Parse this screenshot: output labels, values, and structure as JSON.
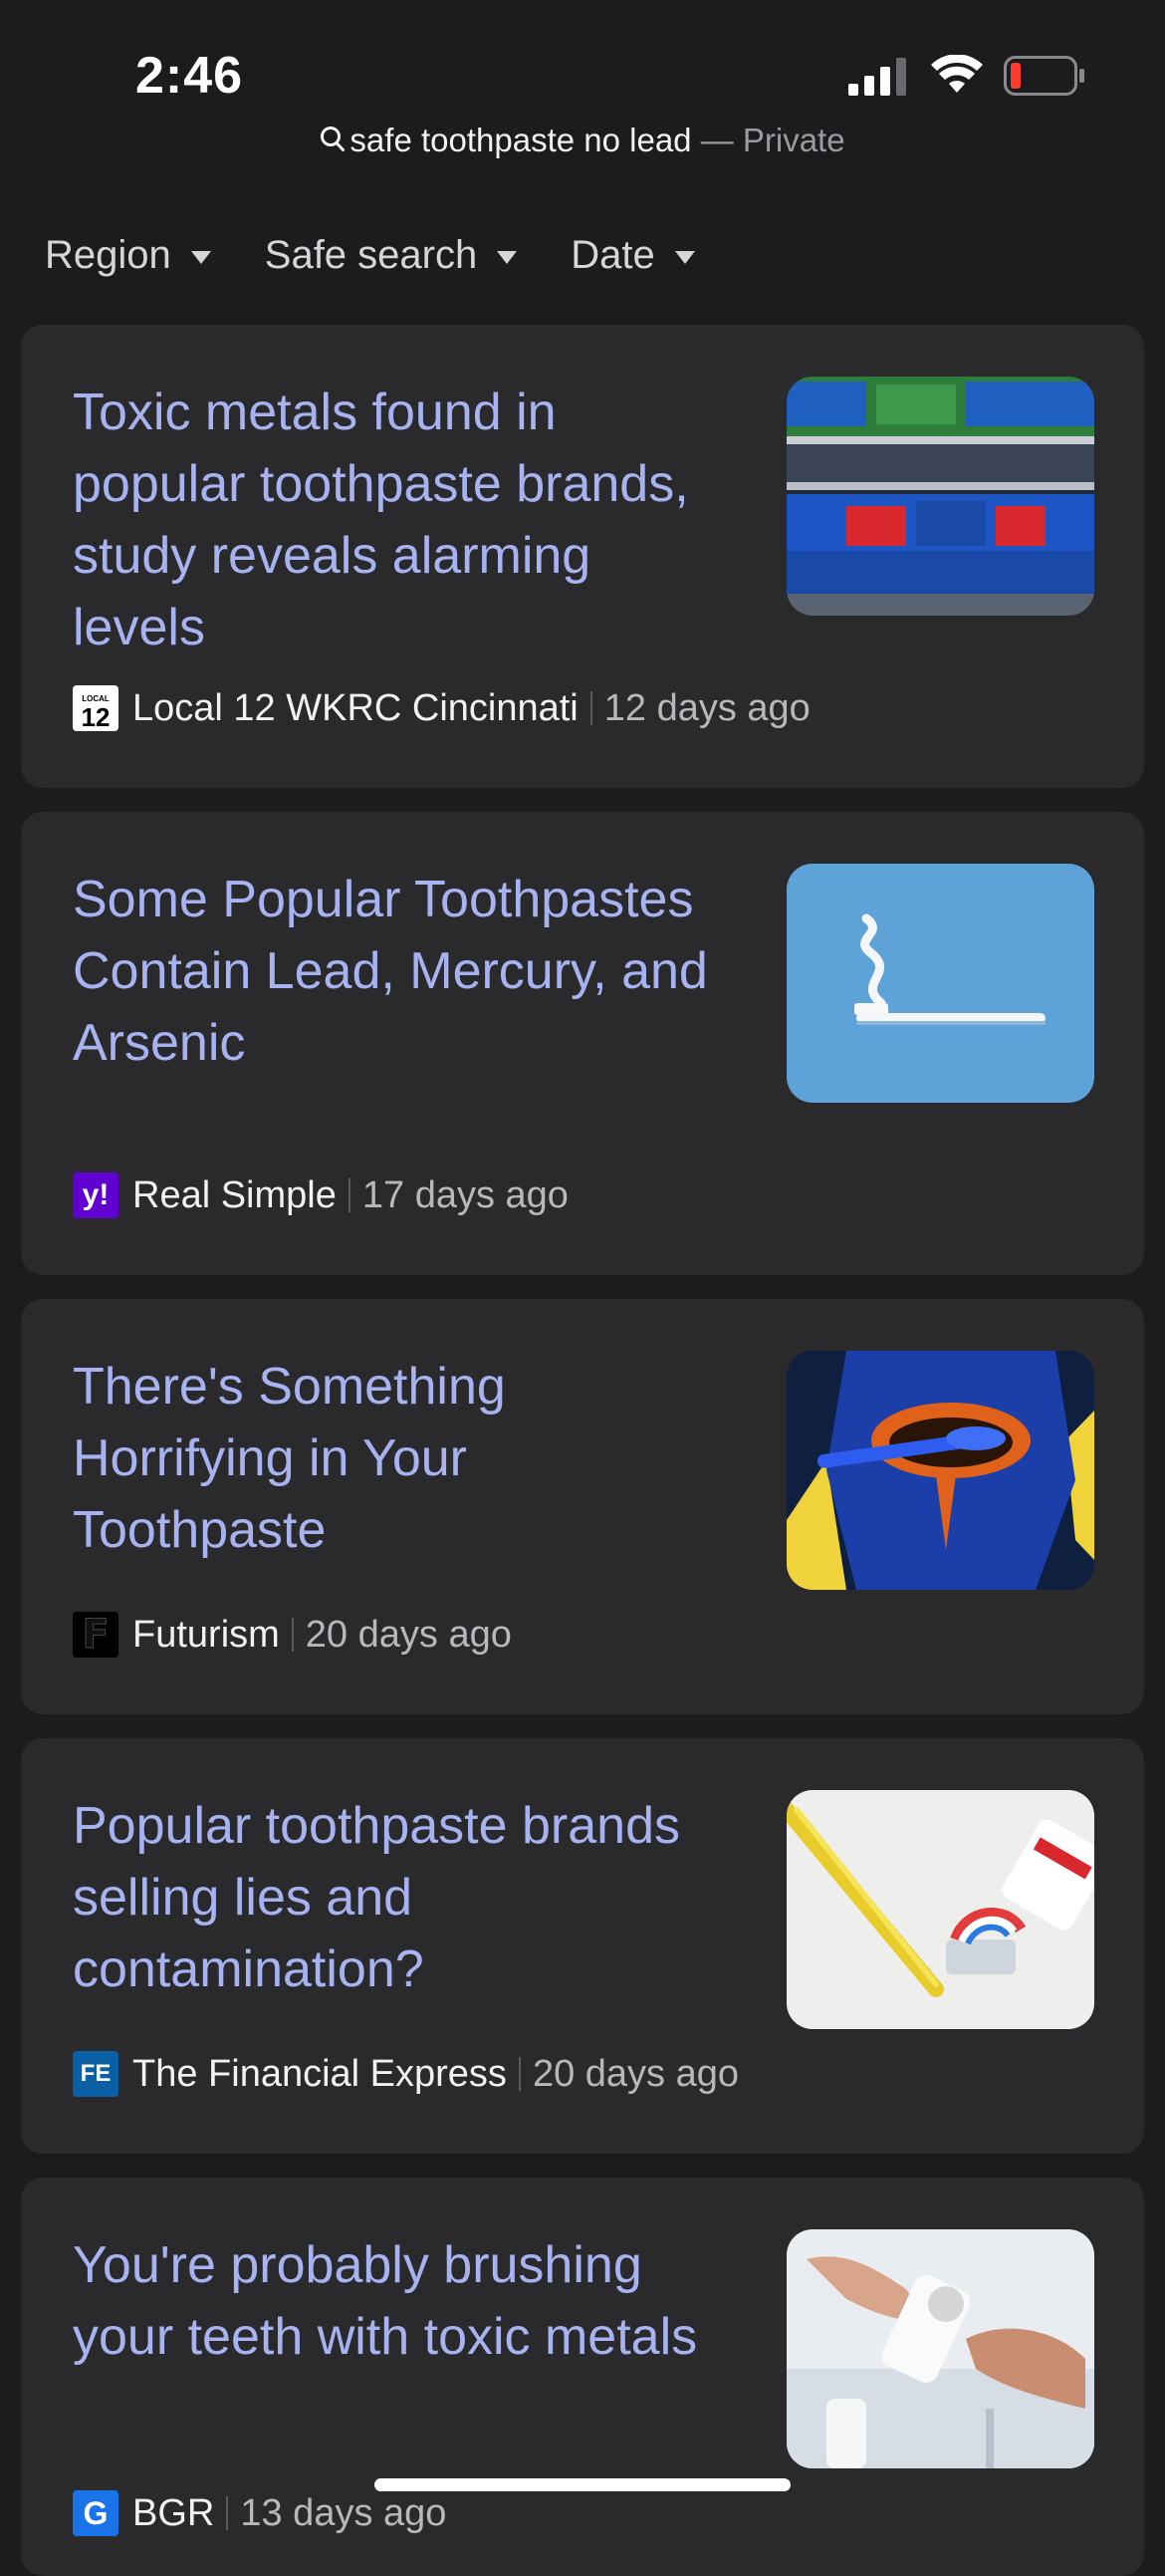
{
  "status_bar": {
    "time": "2:46"
  },
  "search": {
    "query": "safe toothpaste no lead",
    "mode": "— Private"
  },
  "filters": [
    {
      "label": "Region"
    },
    {
      "label": "Safe search"
    },
    {
      "label": "Date"
    }
  ],
  "results": [
    {
      "title": "Toxic metals found in popular toothpaste brands, study reveals alarming levels",
      "source": "Local 12 WKRC Cincinnati",
      "age": "12 days ago",
      "favicon_text": "12",
      "favicon_label": "LOCAL"
    },
    {
      "title": "Some Popular Toothpastes Contain Lead, Mercury, and Arsenic",
      "source": "Real Simple",
      "age": "17 days ago",
      "favicon_text": "y!"
    },
    {
      "title": "There's Something Horrifying in Your Toothpaste",
      "source": "Futurism",
      "age": "20 days ago",
      "favicon_text": "F"
    },
    {
      "title": "Popular toothpaste brands selling lies and contamination?",
      "source": "The Financial Express",
      "age": "20 days ago",
      "favicon_text": "FE"
    },
    {
      "title": "You're probably brushing your teeth with toxic metals",
      "source": "BGR",
      "age": "13 days ago",
      "favicon_text": "G"
    }
  ],
  "colors": {
    "background": "#1c1c1e",
    "card": "#2a2a2c",
    "title_link": "#a6b3f0",
    "battery_low": "#ff3b30"
  }
}
